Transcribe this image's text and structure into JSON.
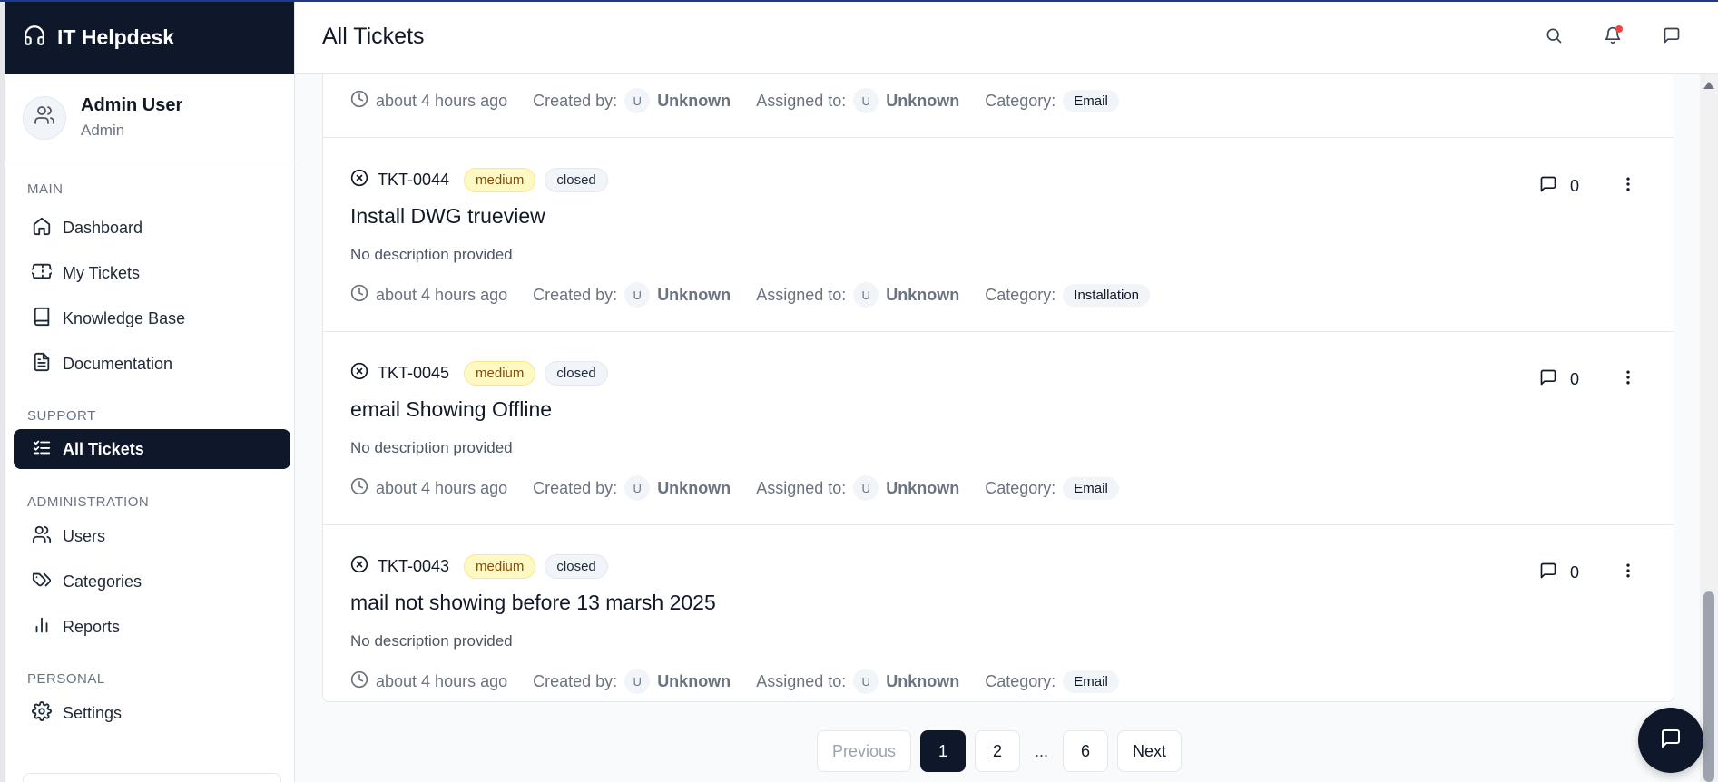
{
  "app": {
    "name": "IT Helpdesk"
  },
  "user": {
    "name": "Admin User",
    "role": "Admin"
  },
  "header": {
    "title": "All Tickets"
  },
  "nav": {
    "sections": [
      {
        "label": "MAIN"
      },
      {
        "label": "SUPPORT"
      },
      {
        "label": "ADMINISTRATION"
      },
      {
        "label": "PERSONAL"
      }
    ],
    "items": [
      {
        "label": "Dashboard",
        "icon": "home-icon"
      },
      {
        "label": "My Tickets",
        "icon": "ticket-icon"
      },
      {
        "label": "Knowledge Base",
        "icon": "book-icon"
      },
      {
        "label": "Documentation",
        "icon": "file-text-icon"
      },
      {
        "label": "All Tickets",
        "icon": "list-checks-icon",
        "active": true
      },
      {
        "label": "Users",
        "icon": "users-icon"
      },
      {
        "label": "Categories",
        "icon": "tags-icon"
      },
      {
        "label": "Reports",
        "icon": "bar-chart-icon"
      },
      {
        "label": "Settings",
        "icon": "gear-icon"
      }
    ]
  },
  "labels": {
    "created_by": "Created by:",
    "assigned_to": "Assigned to:",
    "category": "Category:",
    "avatar_initial": "U"
  },
  "tickets": [
    {
      "id": "",
      "priority": "",
      "status": "",
      "title": "",
      "description": "",
      "time": "about 4 hours ago",
      "created_by": "Unknown",
      "assigned_to": "Unknown",
      "category": "Email",
      "comments": "",
      "partial": true
    },
    {
      "id": "TKT-0044",
      "priority": "medium",
      "status": "closed",
      "title": "Install DWG trueview",
      "description": "No description provided",
      "time": "about 4 hours ago",
      "created_by": "Unknown",
      "assigned_to": "Unknown",
      "category": "Installation",
      "comments": "0"
    },
    {
      "id": "TKT-0045",
      "priority": "medium",
      "status": "closed",
      "title": "email Showing Offline",
      "description": "No description provided",
      "time": "about 4 hours ago",
      "created_by": "Unknown",
      "assigned_to": "Unknown",
      "category": "Email",
      "comments": "0"
    },
    {
      "id": "TKT-0043",
      "priority": "medium",
      "status": "closed",
      "title": "mail not showing before 13 marsh 2025",
      "description": "No description provided",
      "time": "about 4 hours ago",
      "created_by": "Unknown",
      "assigned_to": "Unknown",
      "category": "Email",
      "comments": "0"
    }
  ],
  "pagination": {
    "previous": "Previous",
    "pages": [
      "1",
      "2",
      "...",
      "6"
    ],
    "current": "1",
    "next": "Next"
  },
  "colors": {
    "sidebar_brand_bg": "#0f172a",
    "active_nav_bg": "#0f172a",
    "medium_badge_bg": "#fef9c3",
    "notification_dot": "#ef4444"
  }
}
